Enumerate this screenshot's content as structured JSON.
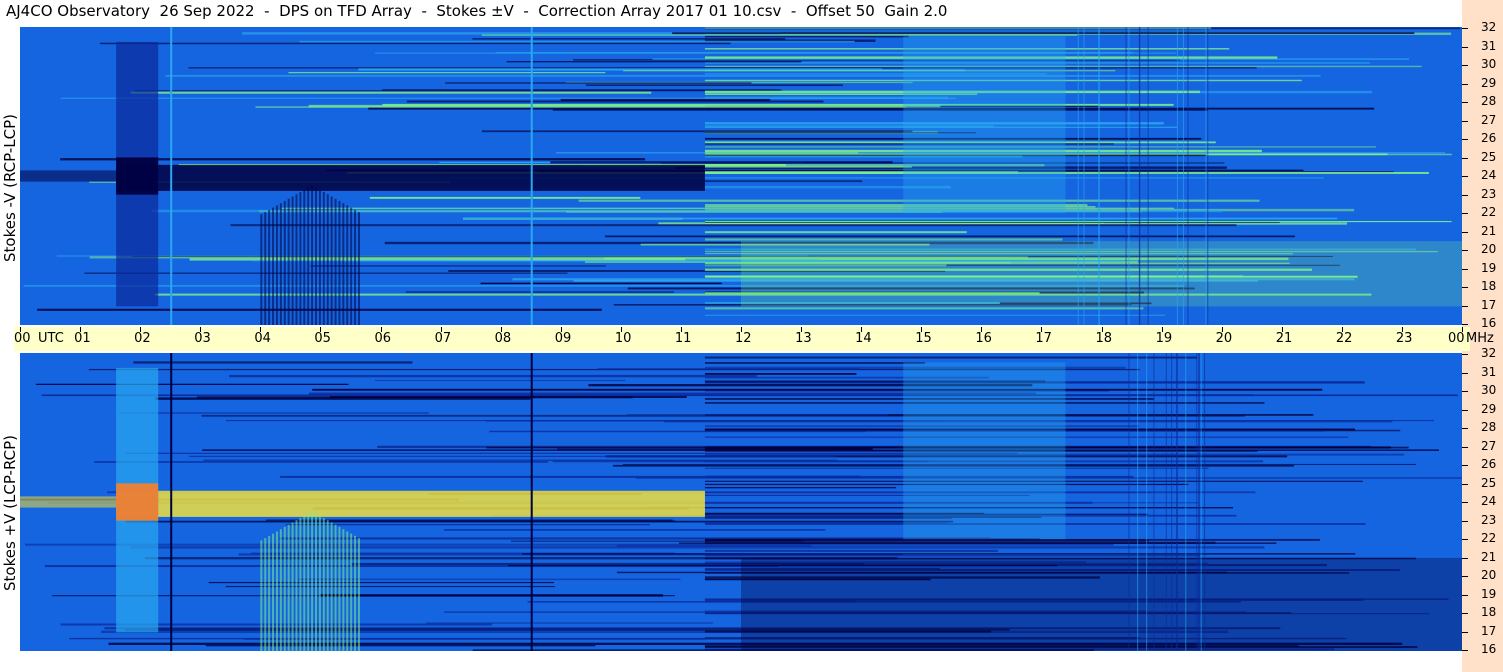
{
  "title": "AJ4CO Observatory  26 Sep 2022  -  DPS on TFD Array  -  Stokes ±V  -  Correction Array 2017 01 10.csv  -  Offset 50  Gain 2.0",
  "chart_data": [
    {
      "type": "heatmap",
      "panel": "top",
      "ylabel": "Stokes -V (RCP-LCP)",
      "x_axis": {
        "labels": [
          "00",
          "UTC",
          "01",
          "02",
          "03",
          "04",
          "05",
          "06",
          "07",
          "08",
          "09",
          "10",
          "11",
          "12",
          "13",
          "14",
          "15",
          "16",
          "17",
          "18",
          "19",
          "20",
          "21",
          "22",
          "23",
          "00",
          "MHz"
        ],
        "range_utc_hours": [
          0,
          24
        ]
      },
      "y_axis": {
        "labels": [
          "32",
          "31",
          "30",
          "29",
          "28",
          "27",
          "26",
          "25",
          "24",
          "23",
          "22",
          "21",
          "20",
          "19",
          "18",
          "17",
          "16"
        ],
        "range_mhz": [
          16,
          32
        ]
      },
      "colormap": [
        "#000040",
        "#0a2a9a",
        "#1565e0",
        "#2aa8f0",
        "#7ef08a",
        "#f0e040",
        "#f08030"
      ]
    },
    {
      "type": "heatmap",
      "panel": "bottom",
      "ylabel": "Stokes +V (LCP-RCP)",
      "x_axis": {
        "labels": [
          "00",
          "UTC",
          "01",
          "02",
          "03",
          "04",
          "05",
          "06",
          "07",
          "08",
          "09",
          "10",
          "11",
          "12",
          "13",
          "14",
          "15",
          "16",
          "17",
          "18",
          "19",
          "20",
          "21",
          "22",
          "23",
          "00",
          "MHz"
        ],
        "range_utc_hours": [
          0,
          24
        ]
      },
      "y_axis": {
        "labels": [
          "32",
          "31",
          "30",
          "29",
          "28",
          "27",
          "26",
          "25",
          "24",
          "23",
          "22",
          "21",
          "20",
          "19",
          "18",
          "17",
          "16"
        ],
        "range_mhz": [
          16,
          32
        ]
      },
      "colormap": [
        "#000040",
        "#0a2a9a",
        "#1565e0",
        "#2aa8f0",
        "#7ef08a",
        "#f0e040",
        "#f08030"
      ]
    }
  ]
}
